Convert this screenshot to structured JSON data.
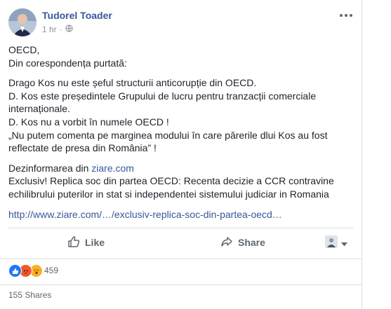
{
  "post": {
    "author": "Tudorel Toader",
    "time": "1 hr",
    "more_icon": "more-dots-icon",
    "privacy_icon": "globe-icon",
    "lines": [
      "OECD,",
      "Din corespondența purtată:"
    ],
    "lines2": [
      "Drago Kos nu este șeful structurii anticorupție din OECD.",
      "D. Kos este președintele Grupului de lucru pentru tranzacții comerciale internaționale.",
      "D. Kos nu a vorbit în numele OECD !",
      "„Nu putem comenta pe marginea modului în care părerile dlui Kos au fost reflectate de presa din România” !"
    ],
    "disinfo_prefix": "Dezinformarea din ",
    "disinfo_link": "ziare.com",
    "headline": "Exclusiv! Replica soc din partea OECD: Recenta decizie a CCR contravine echilibrului puterilor in stat si independentei sistemului judiciar in Romania",
    "url": "http://www.ziare.com/…/exclusiv-replica-soc-din-partea-oecd…"
  },
  "actions": {
    "like": "Like",
    "share": "Share"
  },
  "reactions": {
    "count": "459",
    "types": [
      "like",
      "angry",
      "wow"
    ],
    "colors": {
      "like": "#2078f4",
      "angry": "#f15a29",
      "wow": "#f7b125"
    }
  },
  "shares": "155 Shares"
}
